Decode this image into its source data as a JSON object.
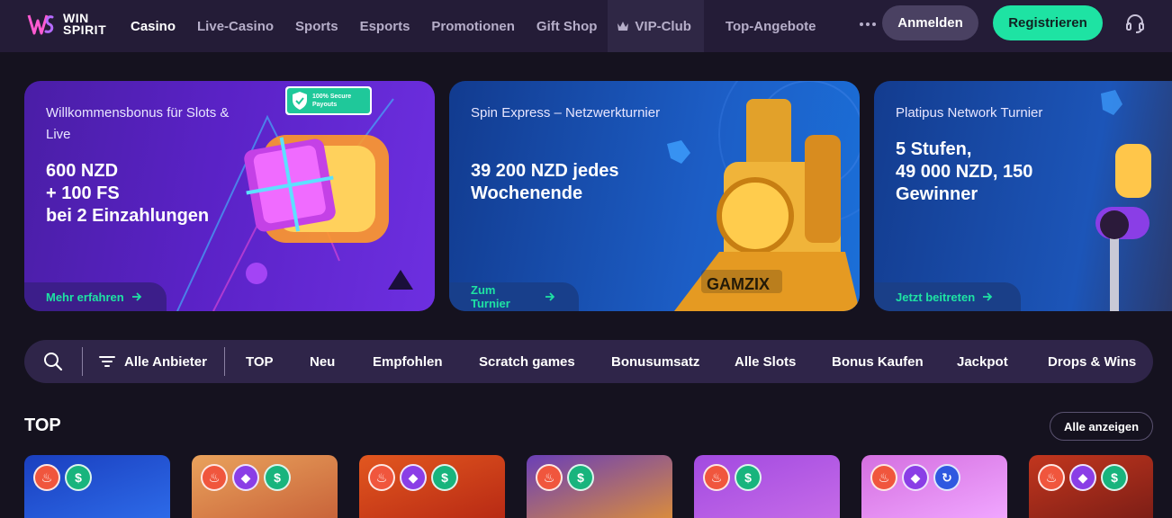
{
  "brand": {
    "name_line1": "WIN",
    "name_line2": "SPIRIT"
  },
  "nav": {
    "links": [
      "Casino",
      "Live-Casino",
      "Sports",
      "Esports",
      "Promotionen",
      "Gift Shop"
    ],
    "vip_label": "VIP-Club",
    "top_label": "Top-Angebote",
    "login_label": "Anmelden",
    "register_label": "Registrieren"
  },
  "banners": [
    {
      "subtitle": "Willkommensbonus für Slots & Live",
      "title_lines": [
        "600 NZD",
        "+ 100 FS",
        "bei 2 Einzahlungen"
      ],
      "cta": "Mehr erfahren",
      "badge": [
        "100% Secure",
        "Payouts"
      ]
    },
    {
      "subtitle": "Spin Express – Netzwerkturnier",
      "title_lines": [
        "39 200 NZD jedes",
        "Wochenende"
      ],
      "cta": "Zum Turnier",
      "provider": "GAMZIX"
    },
    {
      "subtitle": "Platipus Network Turnier",
      "title_lines": [
        "5 Stufen,",
        "49 000 NZD, 150",
        "Gewinner"
      ],
      "cta": "Jetzt beitreten"
    }
  ],
  "filters": {
    "providers_label": "Alle Anbieter",
    "categories": [
      "TOP",
      "Neu",
      "Empfohlen",
      "Scratch games",
      "Bonusumsatz",
      "Alle Slots",
      "Bonus Kaufen",
      "Jackpot",
      "Drops & Wins"
    ]
  },
  "section": {
    "title": "TOP",
    "show_all": "Alle anzeigen"
  },
  "games": [
    {
      "badges": [
        "fire-icon",
        "cash-icon"
      ],
      "bg": [
        "#1a3fbf",
        "#2d6ae8"
      ]
    },
    {
      "badges": [
        "fire-icon",
        "gem-icon",
        "cash-icon"
      ],
      "bg": [
        "#e9a25c",
        "#c9643a"
      ]
    },
    {
      "badges": [
        "fire-icon",
        "gem-icon",
        "cash-icon"
      ],
      "bg": [
        "#e2571f",
        "#b82a14"
      ]
    },
    {
      "badges": [
        "fire-icon",
        "cash-icon"
      ],
      "bg": [
        "#6a3fb8",
        "#d88b3e"
      ]
    },
    {
      "badges": [
        "fire-icon",
        "cash-icon"
      ],
      "bg": [
        "#a24ae0",
        "#c56be8"
      ]
    },
    {
      "badges": [
        "fire-icon",
        "gem-icon",
        "spin-icon"
      ],
      "bg": [
        "#d46fe0",
        "#f0a6ff"
      ]
    },
    {
      "badges": [
        "fire-icon",
        "gem-icon",
        "cash-icon"
      ],
      "bg": [
        "#c2361e",
        "#7d1e16"
      ]
    }
  ],
  "colors": {
    "accent": "#1ee3a3",
    "nav_bg": "#241c37",
    "page_bg": "#15121f"
  }
}
